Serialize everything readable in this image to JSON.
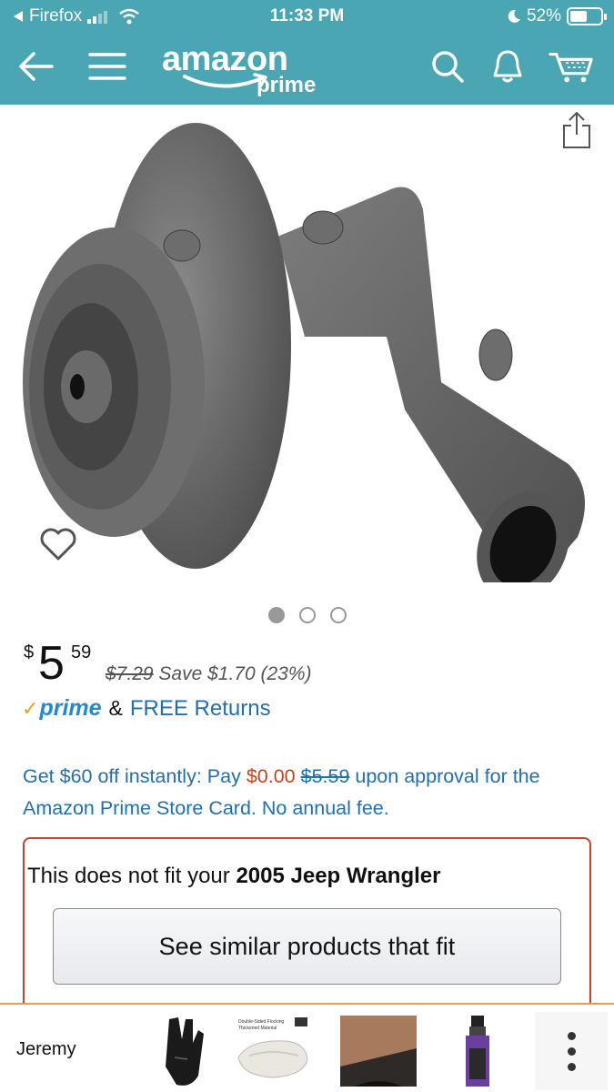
{
  "status_bar": {
    "back_app": "Firefox",
    "time": "11:33 PM",
    "battery": "52%"
  },
  "header": {
    "logo_word": "amazon",
    "logo_prime": "prime",
    "icons": [
      "back-arrow-icon",
      "menu-icon",
      "search-icon",
      "bell-icon",
      "cart-icon"
    ]
  },
  "product": {
    "image_count": 3,
    "active_image_index": 0,
    "price": {
      "symbol": "$",
      "whole": "5",
      "fraction": "59"
    },
    "list_price": "$7.29",
    "savings": "Save $1.70 (23%)",
    "prime_label": "prime",
    "amp": "&",
    "free_returns": "FREE Returns"
  },
  "promo": {
    "part1": "Get $60 off instantly: Pay ",
    "pay_amount": "$0.00",
    "struck_amount": "$5.59",
    "part2": " upon approval for the Amazon Prime Store Card. No annual fee."
  },
  "fitment": {
    "prefix": "This does not fit your ",
    "vehicle": "2005 Jeep Wrangler",
    "button": "See similar products that fit"
  },
  "bottom_bar": {
    "user": "Jeremy",
    "thumb2_caption_line1": "Double-Sided Flocking",
    "thumb2_caption_line2": "Thickened Material"
  },
  "colors": {
    "header_bg": "#4aa6b3",
    "link_blue": "#1f6fb2",
    "prime_blue": "#1f8ad3",
    "prime_check": "#f39b1d",
    "accent_orange": "#c4451c",
    "fit_border": "#c4432b"
  }
}
